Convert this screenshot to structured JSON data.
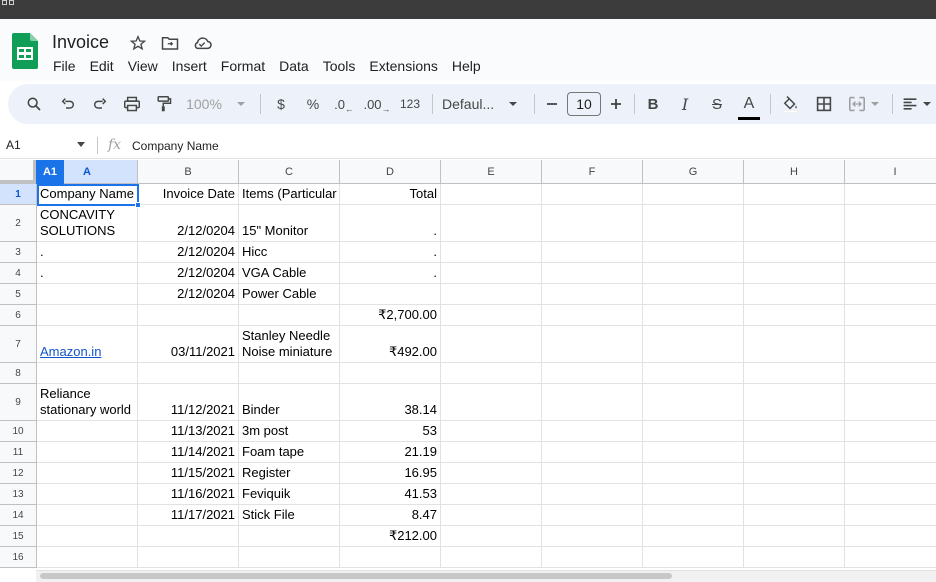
{
  "app": {
    "doc_title": "Invoice",
    "brand_color": "#0f9d58"
  },
  "menu": [
    "File",
    "Edit",
    "View",
    "Insert",
    "Format",
    "Data",
    "Tools",
    "Extensions",
    "Help"
  ],
  "toolbar": {
    "zoom": "100%",
    "currency": "$",
    "percent": "%",
    "decrease_decimals": ".0",
    "increase_decimals": ".00",
    "number_format": "123",
    "font_name": "Defaul...",
    "font_size": "10",
    "bold": "B",
    "italic": "I",
    "strike": "S",
    "text_color": "A"
  },
  "formula_bar": {
    "name_box": "A1",
    "fx": "fx",
    "value": "Company Name"
  },
  "grid": {
    "active_cell": "A1",
    "columns": [
      "A",
      "B",
      "C",
      "D",
      "E",
      "F",
      "G",
      "H",
      "I"
    ],
    "rows": [
      "1",
      "2",
      "3",
      "4",
      "5",
      "6",
      "7",
      "8",
      "9",
      "10",
      "11",
      "12",
      "13",
      "14",
      "15",
      "16"
    ],
    "cells": {
      "A1": "Company Name",
      "B1": "Invoice Date",
      "C1": "Items (Particular",
      "D1": "Total",
      "A2": "CONCAVITY SOLUTIONS",
      "B2": "2/12/0204",
      "C2": "15\" Monitor",
      "D2": ".",
      "A3": ".",
      "B3": "2/12/0204",
      "C3": "Hicc",
      "D3": ".",
      "A4": ".",
      "B4": "2/12/0204",
      "C4": "VGA Cable",
      "D4": ".",
      "B5": "2/12/0204",
      "C5": "Power Cable",
      "D6": "₹2,700.00",
      "A7": "Amazon.in",
      "B7": "03/11/2021",
      "C7": "Stanley Needle Noise miniature",
      "D7": "₹492.00",
      "A9": "Reliance stationary world",
      "B9": "11/12/2021",
      "C9": "Binder",
      "D9": "38.14",
      "B10": "11/13/2021",
      "C10": "3m post",
      "D10": "53",
      "B11": "11/14/2021",
      "C11": "Foam tape",
      "D11": "21.19",
      "B12": "11/15/2021",
      "C12": "Register",
      "D12": "16.95",
      "B13": "11/16/2021",
      "C13": "Feviquik",
      "D13": "41.53",
      "B14": "11/17/2021",
      "C14": "Stick File",
      "D14": "8.47",
      "D15": "₹212.00"
    }
  }
}
